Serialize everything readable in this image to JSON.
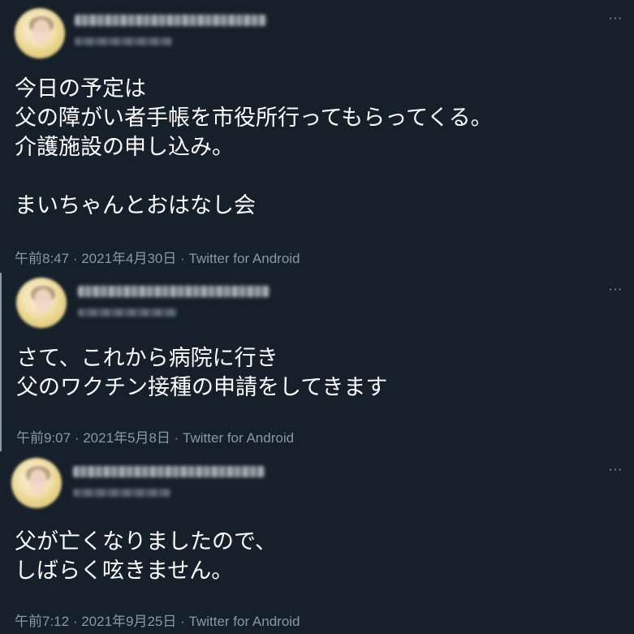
{
  "more_icon_glyph": "···",
  "separator": " · ",
  "tweets": [
    {
      "text": "今日の予定は\n父の障がい者手帳を市役所行ってもらってくる。\n介護施設の申し込み。\n\nまいちゃんとおはなし会",
      "time": "午前8:47",
      "date": "2021年4月30日",
      "source": "Twitter for Android"
    },
    {
      "text": "さて、これから病院に行き\n父のワクチン接種の申請をしてきます",
      "time": "午前9:07",
      "date": "2021年5月8日",
      "source": "Twitter for Android"
    },
    {
      "text": "父が亡くなりましたので、\nしばらく呟きません。",
      "time": "午前7:12",
      "date": "2021年9月25日",
      "source": "Twitter for Android"
    }
  ]
}
